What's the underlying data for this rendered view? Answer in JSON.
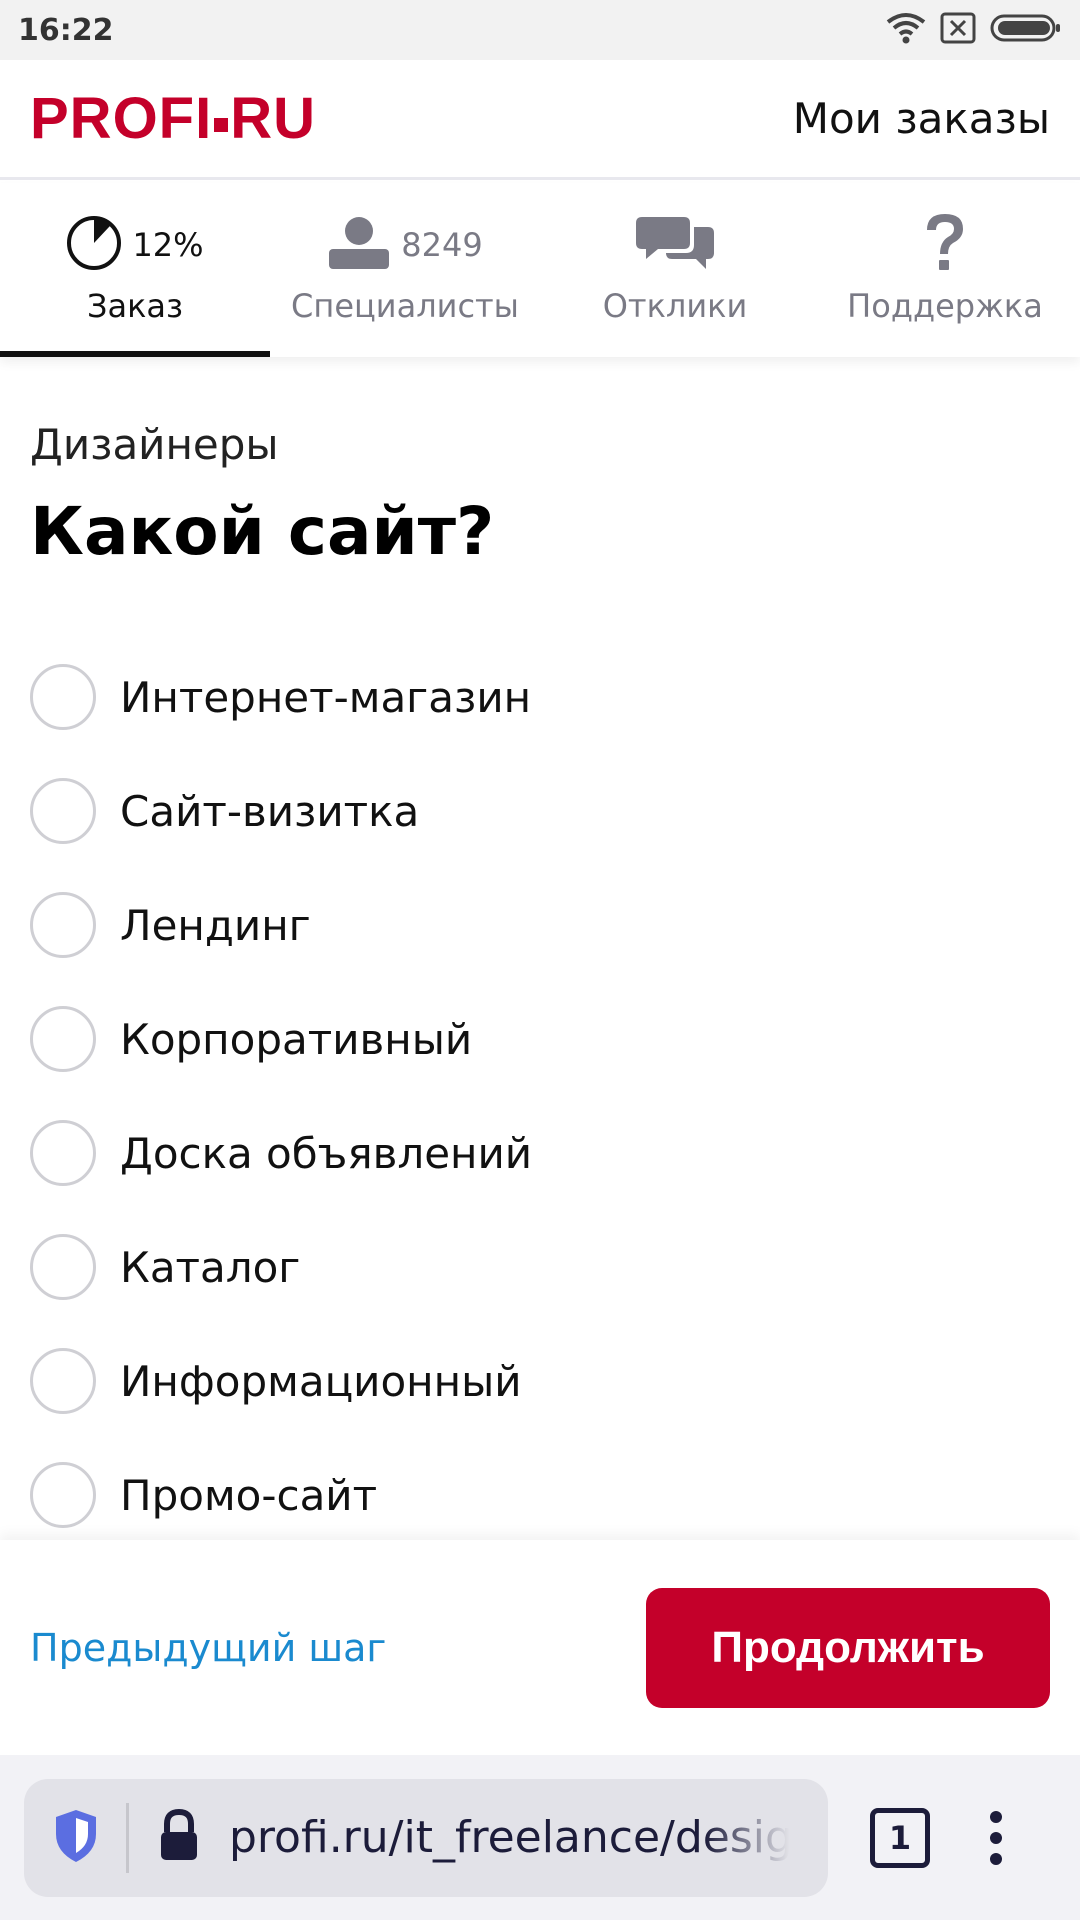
{
  "status_bar": {
    "time": "16:22"
  },
  "header": {
    "logo": "PROFI.RU",
    "logo_left": "PROFI",
    "logo_right": "RU",
    "my_orders": "Мои заказы"
  },
  "tabs": [
    {
      "label": "Заказ",
      "meta": "12%",
      "icon": "progress-pie-icon",
      "active": true
    },
    {
      "label": "Специалисты",
      "meta": "8249",
      "icon": "person-icon"
    },
    {
      "label": "Отклики",
      "meta": "",
      "icon": "chat-bubbles-icon"
    },
    {
      "label": "Поддержка",
      "meta": "",
      "icon": "question-icon"
    }
  ],
  "progress": {
    "percent": 12
  },
  "content": {
    "category": "Дизайнеры",
    "question": "Какой сайт?",
    "options": [
      "Интернет-магазин",
      "Сайт-визитка",
      "Лендинг",
      "Корпоративный",
      "Доска объявлений",
      "Каталог",
      "Информационный",
      "Промо-сайт"
    ]
  },
  "actions": {
    "prev": "Предыдущий шаг",
    "continue": "Продолжить"
  },
  "browser": {
    "url": "profi.ru/it_freelance/designe",
    "tab_count": "1"
  },
  "colors": {
    "brand": "#c4002a",
    "link": "#1a8acf",
    "tab_inactive": "#7a7a85"
  }
}
